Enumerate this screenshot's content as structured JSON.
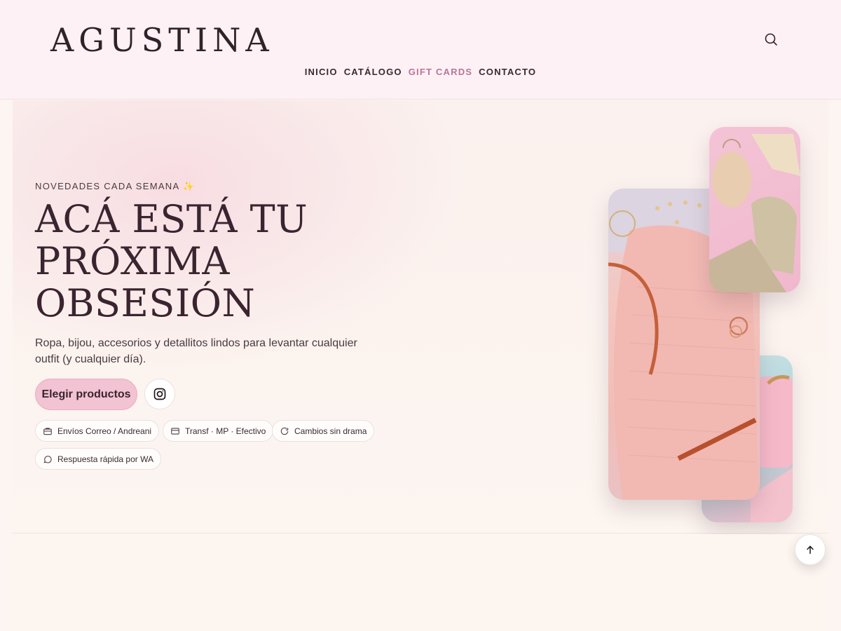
{
  "brand": {
    "name": "AGUSTINA"
  },
  "nav": {
    "items": [
      {
        "label": "INICIO",
        "active": false
      },
      {
        "label": "CATÁLOGO",
        "active": false
      },
      {
        "label": "GIFT CARDS",
        "active": true
      },
      {
        "label": "CONTACTO",
        "active": false
      }
    ]
  },
  "hero": {
    "eyebrow": "NOVEDADES CADA SEMANA",
    "eyebrow_emoji": "✨",
    "headline_lines": [
      "ACÁ ESTÁ TU",
      "PRÓXIMA",
      "OBSESIÓN"
    ],
    "subtext": "Ropa, bijou, accesorios y detallitos lindos para levantar cualquier outfit (y cualquier día).",
    "cta_label": "Elegir productos",
    "chips": [
      {
        "label": "Envíos Correo / Andreani",
        "icon": "box-icon"
      },
      {
        "label": "Transf · MP · Efectivo",
        "icon": "card-icon"
      },
      {
        "label": "Cambios sin drama",
        "icon": "refresh-icon"
      },
      {
        "label": "Respuesta rápida por WA",
        "icon": "chat-icon"
      }
    ]
  },
  "colors": {
    "header_bg": "#fdf1f5",
    "accent": "#b87598",
    "cta_bg": "#f2c3d2",
    "text": "#3a2430"
  }
}
